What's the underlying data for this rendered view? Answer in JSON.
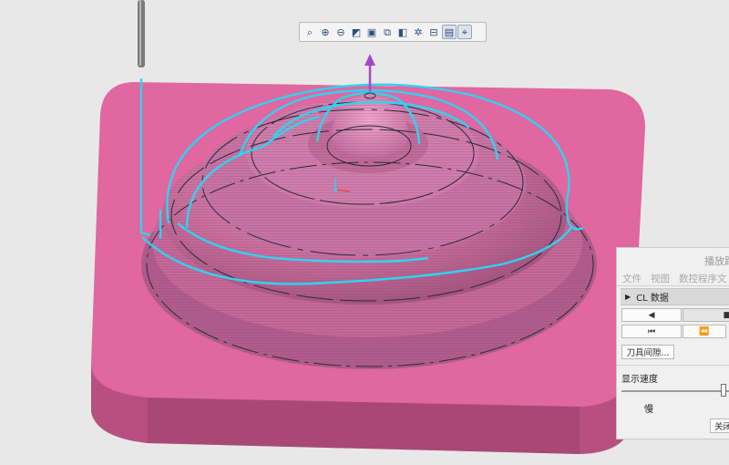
{
  "viewport": {
    "colors": {
      "background": "#e8e8e8",
      "part": "#e06aa2",
      "part_shadow": "#b44f80",
      "toolpath": "#2fd3f0",
      "axis_arrow": "#a349c7",
      "tool": "#6e6e6e"
    }
  },
  "view_toolbar": {
    "buttons": [
      {
        "name": "zoom-fit-icon",
        "glyph": "⌕"
      },
      {
        "name": "zoom-in-icon",
        "glyph": "⊕"
      },
      {
        "name": "zoom-out-icon",
        "glyph": "⊖"
      },
      {
        "name": "repaint-icon",
        "glyph": "◩"
      },
      {
        "name": "saved-orientations-icon",
        "glyph": "▣"
      },
      {
        "name": "view-manager-icon",
        "glyph": "⧉"
      },
      {
        "name": "display-style-icon",
        "glyph": "◧"
      },
      {
        "name": "datum-display-icon",
        "glyph": "✲"
      },
      {
        "name": "annotation-display-icon",
        "glyph": "⊟"
      },
      {
        "name": "spin-center-icon",
        "glyph": "▤"
      },
      {
        "name": "toolpath-display-icon",
        "glyph": "⌖"
      }
    ]
  },
  "playback_panel": {
    "title": "播放路",
    "menu": [
      "文件",
      "视图",
      "数控程序文"
    ],
    "cl_section_label": "CL 数据",
    "controls_row1": [
      "◀",
      "■"
    ],
    "controls_row2": [
      "⏮",
      "⏪"
    ],
    "tool_clearance_label": "刀具间隙...",
    "display_speed_label": "显示速度",
    "speed_slow_label": "慢",
    "close_label": "关闭"
  }
}
